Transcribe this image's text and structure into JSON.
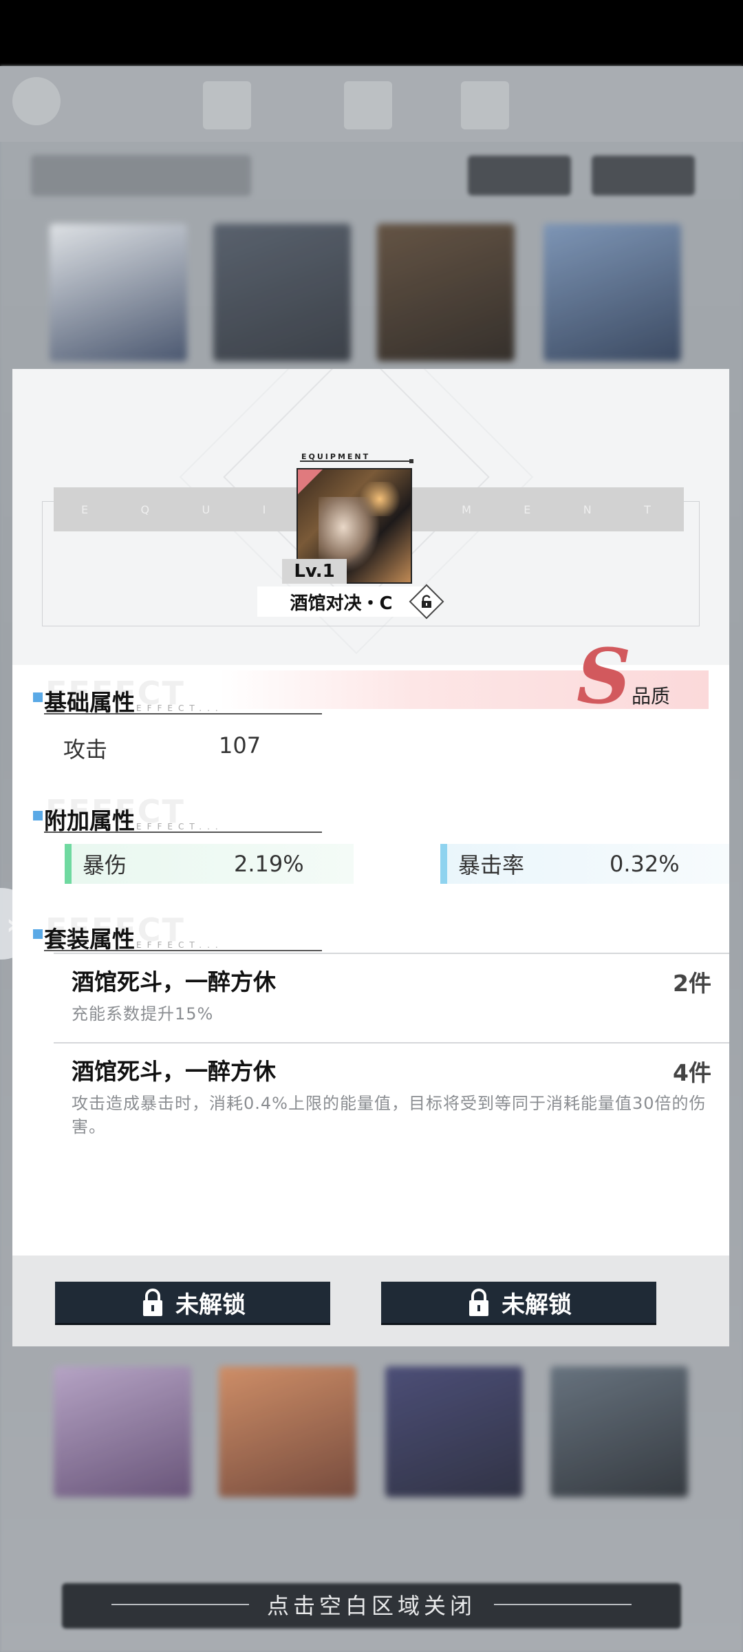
{
  "header": {
    "equipment_label": "EQUIPMENT",
    "band_letters": [
      "E",
      "Q",
      "U",
      "I",
      "",
      "M",
      "E",
      "N",
      "T"
    ],
    "level": "Lv.1",
    "item_name": "酒馆对决・C",
    "lock_icon": "unlock-icon"
  },
  "quality": {
    "grade": "S",
    "label": "品质",
    "color": "#d2595d"
  },
  "sections": {
    "base": {
      "title": "基础属性",
      "ghost": "EFFECT",
      "sub": "EFFECT..."
    },
    "extra": {
      "title": "附加属性",
      "ghost": "EFFECT",
      "sub": "EFFECT..."
    },
    "set": {
      "title": "套装属性",
      "ghost": "EFFECT",
      "sub": "EFFECT..."
    }
  },
  "base_stats": {
    "attack_label": "攻击",
    "attack_value": "107"
  },
  "extra_stats": [
    {
      "label": "暴伤",
      "value": "2.19%",
      "color": "#6fd9a0"
    },
    {
      "label": "暴击率",
      "value": "0.32%",
      "color": "#8fd3ef"
    }
  ],
  "set_bonuses": [
    {
      "name": "酒馆死斗，一醉方休",
      "count": "2件",
      "desc": "充能系数提升15%"
    },
    {
      "name": "酒馆死斗，一醉方休",
      "count": "4件",
      "desc": "攻击造成暴击时，消耗0.4%上限的能量值，目标将受到等同于消耗能量值30倍的伤害。"
    }
  ],
  "buttons": {
    "left_label": "未解锁",
    "right_label": "未解锁"
  },
  "close_hint": "点击空白区域关闭"
}
